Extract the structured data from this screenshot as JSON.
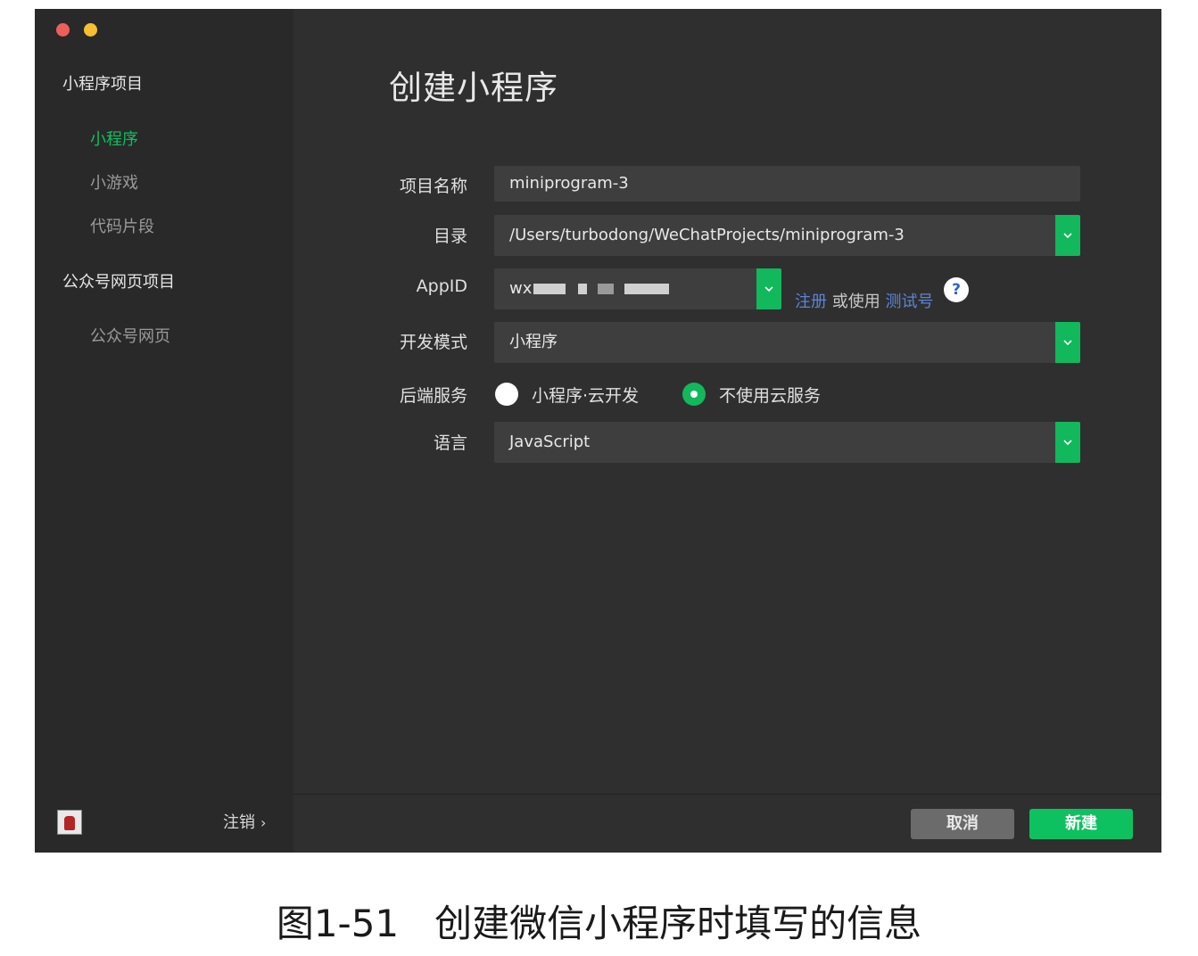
{
  "sidebar": {
    "group1": "小程序项目",
    "items1": [
      "小程序",
      "小游戏",
      "代码片段"
    ],
    "group2": "公众号网页项目",
    "items2": [
      "公众号网页"
    ],
    "logout": "注销",
    "logout_chevron": "›"
  },
  "main": {
    "title": "创建小程序",
    "fields": {
      "project_name_label": "项目名称",
      "project_name_value": "miniprogram-3",
      "directory_label": "目录",
      "directory_value": "/Users/turbodong/WeChatProjects/miniprogram-3",
      "appid_label": "AppID",
      "appid_value": "wx",
      "register_link": "注册",
      "or_use": "或使用",
      "test_account_link": "测试号",
      "help": "?",
      "dev_mode_label": "开发模式",
      "dev_mode_value": "小程序",
      "backend_label": "后端服务",
      "backend_option_cloud": "小程序·云开发",
      "backend_option_none": "不使用云服务",
      "backend_selected": "不使用云服务",
      "language_label": "语言",
      "language_value": "JavaScript"
    },
    "buttons": {
      "cancel": "取消",
      "create": "新建"
    }
  },
  "caption": {
    "number": "图1-51",
    "text": "创建微信小程序时填写的信息"
  },
  "colors": {
    "accent_green": "#0ec160",
    "link_blue": "#5c84d6",
    "window_bg": "#2f2f2f",
    "sidebar_bg": "#292929"
  },
  "icons": [
    "close-dot-icon",
    "minimize-dot-icon",
    "chevron-down-icon",
    "help-icon",
    "avatar-icon",
    "chevron-right-icon"
  ]
}
